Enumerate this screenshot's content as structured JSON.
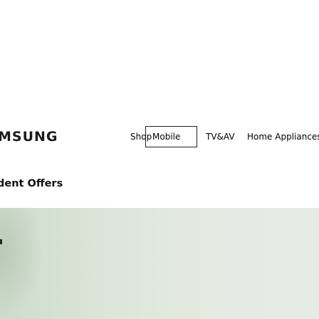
{
  "header": {
    "logo_text": "MSUNG",
    "nav": {
      "shop_label": "Shop",
      "mobile_label": "Mobile",
      "tvav_label": "TV&AV",
      "home_appliances_label": "Home Appliances"
    }
  },
  "main": {
    "offers_heading": "dent Offers"
  },
  "colors": {
    "hero_background": "#dde6db",
    "nav_border": "#000000"
  }
}
